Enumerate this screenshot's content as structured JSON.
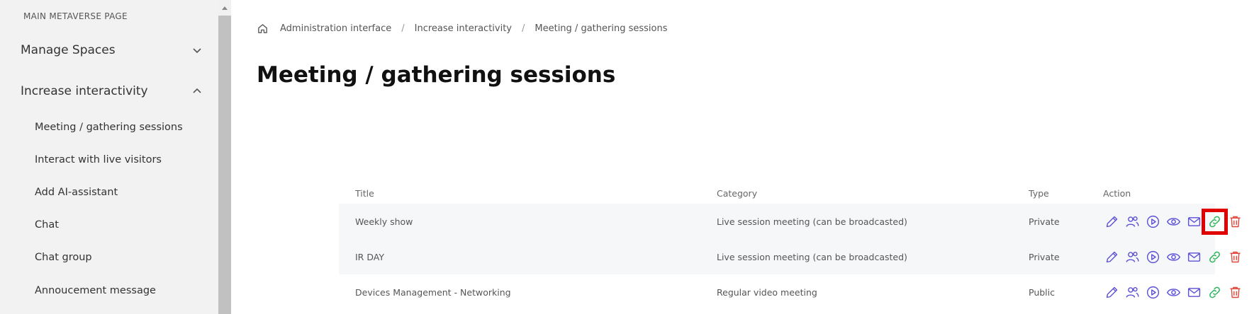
{
  "sidebar": {
    "section_title": "MAIN METAVERSE PAGE",
    "groups": [
      {
        "label": "Manage Spaces",
        "expanded": false
      },
      {
        "label": "Increase interactivity",
        "expanded": true
      }
    ],
    "sub_items": [
      "Meeting / gathering sessions",
      "Interact with live visitors",
      "Add AI-assistant",
      "Chat",
      "Chat group",
      "Annoucement message"
    ]
  },
  "breadcrumb": {
    "home_icon": "home-icon",
    "items": [
      "Administration interface",
      "Increase interactivity",
      "Meeting / gathering sessions"
    ],
    "separator": "/"
  },
  "page_title": "Meeting / gathering sessions",
  "table": {
    "headers": {
      "title": "Title",
      "category": "Category",
      "type": "Type",
      "action": "Action"
    },
    "rows": [
      {
        "title": "Weekly show",
        "category": "Live session meeting (can be broadcasted)",
        "type": "Private"
      },
      {
        "title": "IR DAY",
        "category": "Live session meeting (can be broadcasted)",
        "type": "Private"
      },
      {
        "title": "Devices Management - Networking",
        "category": "Regular video meeting",
        "type": "Public"
      }
    ],
    "actions": [
      "edit-icon",
      "users-icon",
      "play-icon",
      "view-icon",
      "mail-icon",
      "link-icon",
      "delete-icon"
    ]
  },
  "colors": {
    "icon_purple": "#5b4fd6",
    "icon_green": "#2fb55c",
    "icon_red": "#e0473b",
    "highlight": "#e00000"
  }
}
